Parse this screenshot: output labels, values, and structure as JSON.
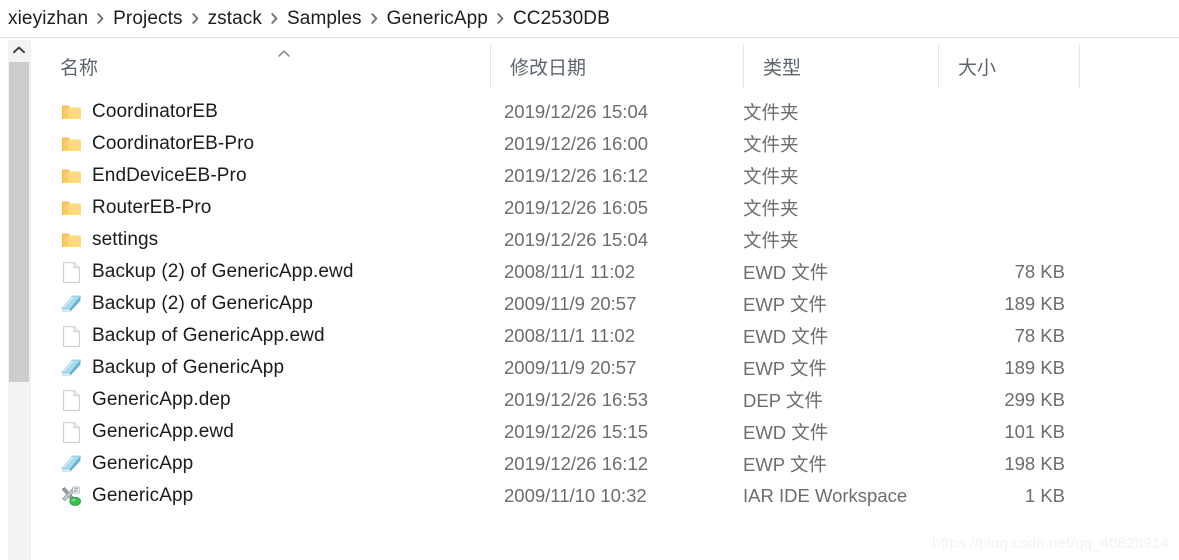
{
  "breadcrumb": {
    "separator_icon": "chevron-right-icon",
    "items": [
      "xieyizhan",
      "Projects",
      "zstack",
      "Samples",
      "GenericApp",
      "CC2530DB"
    ]
  },
  "scrollbar": {
    "up_button_icon": "chevron-up-icon"
  },
  "columns": {
    "sort_indicator_icon": "chevron-up-icon",
    "headers": [
      {
        "label": "名称",
        "name": "name"
      },
      {
        "label": "修改日期",
        "name": "date-modified"
      },
      {
        "label": "类型",
        "name": "type"
      },
      {
        "label": "大小",
        "name": "size"
      }
    ]
  },
  "files": [
    {
      "icon": "folder-icon",
      "name": "CoordinatorEB",
      "date": "2019/12/26 15:04",
      "type": "文件夹",
      "size": ""
    },
    {
      "icon": "folder-icon",
      "name": "CoordinatorEB-Pro",
      "date": "2019/12/26 16:00",
      "type": "文件夹",
      "size": ""
    },
    {
      "icon": "folder-icon",
      "name": "EndDeviceEB-Pro",
      "date": "2019/12/26 16:12",
      "type": "文件夹",
      "size": ""
    },
    {
      "icon": "folder-icon",
      "name": "RouterEB-Pro",
      "date": "2019/12/26 16:05",
      "type": "文件夹",
      "size": ""
    },
    {
      "icon": "folder-icon",
      "name": "settings",
      "date": "2019/12/26 15:04",
      "type": "文件夹",
      "size": ""
    },
    {
      "icon": "document-icon",
      "name": "Backup (2) of GenericApp.ewd",
      "date": "2008/11/1 11:02",
      "type": "EWD 文件",
      "size": "78 KB"
    },
    {
      "icon": "ewp-project-icon",
      "name": "Backup (2) of GenericApp",
      "date": "2009/11/9 20:57",
      "type": "EWP 文件",
      "size": "189 KB"
    },
    {
      "icon": "document-icon",
      "name": "Backup of GenericApp.ewd",
      "date": "2008/11/1 11:02",
      "type": "EWD 文件",
      "size": "78 KB"
    },
    {
      "icon": "ewp-project-icon",
      "name": "Backup of GenericApp",
      "date": "2009/11/9 20:57",
      "type": "EWP 文件",
      "size": "189 KB"
    },
    {
      "icon": "document-icon",
      "name": "GenericApp.dep",
      "date": "2019/12/26 16:53",
      "type": "DEP 文件",
      "size": "299 KB"
    },
    {
      "icon": "document-icon",
      "name": "GenericApp.ewd",
      "date": "2019/12/26 15:15",
      "type": "EWD 文件",
      "size": "101 KB"
    },
    {
      "icon": "ewp-project-icon",
      "name": "GenericApp",
      "date": "2019/12/26 16:12",
      "type": "EWP 文件",
      "size": "198 KB"
    },
    {
      "icon": "iar-workspace-icon",
      "name": "GenericApp",
      "date": "2009/11/10 10:32",
      "type": "IAR IDE Workspace",
      "size": "1 KB"
    }
  ],
  "watermark": {
    "text": "https://blog.csdn.net/qq_40828914"
  },
  "colors": {
    "folder": "#ffd076",
    "ewp_blue": "#7fc5dd",
    "iar_green": "#39b54a",
    "header_text": "#5d6470",
    "secondary_text": "#6d6d6d",
    "scrollbar_thumb": "#cdcdcd"
  }
}
